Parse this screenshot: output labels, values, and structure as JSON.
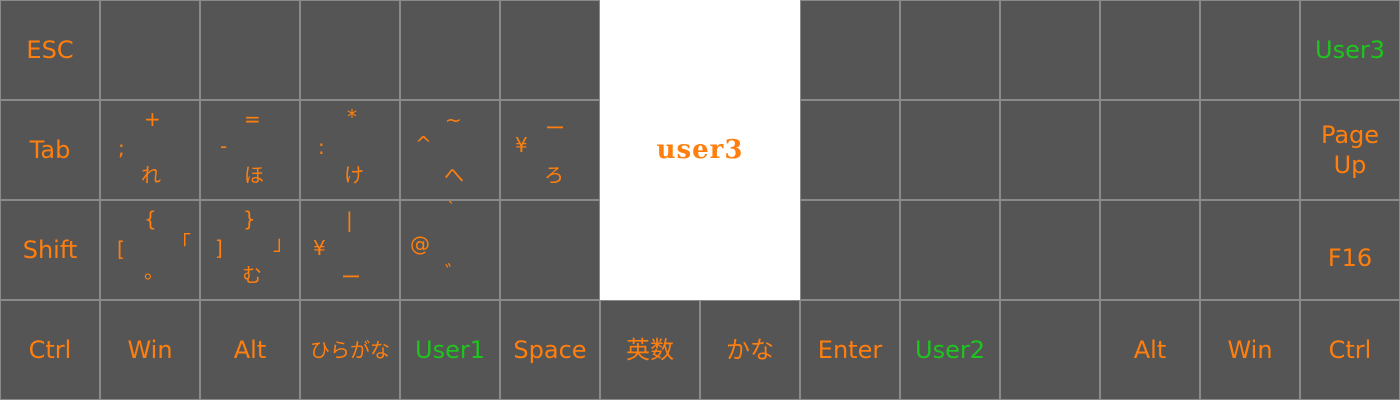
{
  "layer": {
    "name": "user3"
  },
  "colors": {
    "key_bg": "#555555",
    "key_border": "#8a8a8a",
    "legend": "#ff7f0e",
    "user_legend": "#1ec51e",
    "background": "#ffffff"
  },
  "row0": {
    "k0": "ESC",
    "k13": "User3"
  },
  "row1": {
    "k0": "Tab",
    "k1": {
      "top": "+",
      "left": ";",
      "bottom": "れ"
    },
    "k2": {
      "top": "=",
      "left": "-",
      "bottom": "ほ"
    },
    "k3": {
      "top": "*",
      "left": ":",
      "bottom": "け"
    },
    "k4": {
      "top": "~",
      "left": "^",
      "bottom": "へ"
    },
    "k5": {
      "top": "ー",
      "left": "¥",
      "bottom": "ろ"
    },
    "k13": "Page\nUp"
  },
  "row2": {
    "k0": "Shift",
    "k1": {
      "top": "{",
      "left": "[",
      "right": "「",
      "bottom": "。"
    },
    "k2": {
      "top": "}",
      "left": "]",
      "right": "」",
      "bottom": "む"
    },
    "k3": {
      "top": "|",
      "left": "¥",
      "bottom": "ー"
    },
    "k4": {
      "top": "`",
      "left": "@",
      "bottom": "゛"
    },
    "k13": "F16"
  },
  "row3": {
    "k0": "Ctrl",
    "k1": "Win",
    "k2": "Alt",
    "k3": "ひらがな",
    "k4": "User1",
    "k5": "Space",
    "k6": "英数",
    "k7": "かな",
    "k8": "Enter",
    "k9": "User2",
    "k11": "Alt",
    "k12": "Win",
    "k13": "Ctrl"
  }
}
